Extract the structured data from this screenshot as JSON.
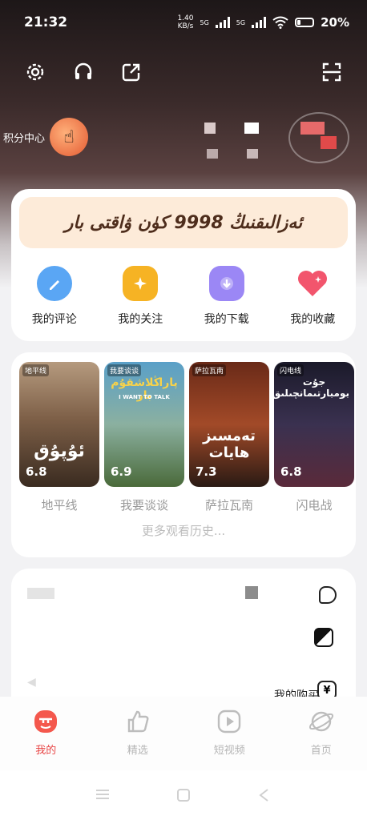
{
  "status": {
    "time": "21:32",
    "net_speed_value": "1.40",
    "net_speed_unit": "KB/s",
    "net_5g_a": "5G",
    "net_5g_b": "5G",
    "battery": "20%"
  },
  "toolbar": {
    "settings_icon": "gear-icon",
    "support_icon": "headset-icon",
    "share_icon": "external-share-icon",
    "scan_icon": "scan-icon"
  },
  "points": {
    "label": "积分中心"
  },
  "banner": {
    "text": "ئەزالىقنىڭ 9998 كۈن ۋاقتى بار"
  },
  "quick_actions": [
    {
      "label": "我的评论",
      "icon": "comment-icon",
      "color": "#5aa6f4"
    },
    {
      "label": "我的关注",
      "icon": "star-icon",
      "color": "#f6b324"
    },
    {
      "label": "我的下载",
      "icon": "download-icon",
      "color": "#9b87f5"
    },
    {
      "label": "我的收藏",
      "icon": "heart-icon",
      "color": "#f2556d"
    }
  ],
  "history": {
    "items": [
      {
        "tag": "地平线",
        "score": "6.8",
        "title": "地平线",
        "art": "ئۇپۇق"
      },
      {
        "tag": "我要谈谈",
        "score": "6.9",
        "title": "我要谈谈",
        "art": "پاراڭلاشقۇم بار",
        "subtitle": "I WANT TO TALK"
      },
      {
        "tag": "萨拉瓦南",
        "score": "7.3",
        "title": "萨拉瓦南",
        "art": "تەمسىز ھايات"
      },
      {
        "tag": "闪电线",
        "score": "6.8",
        "title": "闪电战",
        "art": "جۇت بومبارتىمانچىلىق"
      }
    ],
    "more": "更多观看历史..."
  },
  "purchase": {
    "label": "我的购买",
    "icon": "yen-icon"
  },
  "tabs": [
    {
      "label": "我的",
      "icon": "profile-icon",
      "active": true
    },
    {
      "label": "精选",
      "icon": "thumbs-up-icon",
      "active": false
    },
    {
      "label": "短视频",
      "icon": "video-icon",
      "active": false
    },
    {
      "label": "首页",
      "icon": "planet-icon",
      "active": false
    }
  ],
  "colors": {
    "accent": "#e84545",
    "banner_bg": "#fdebd9",
    "banner_text": "#4e2d1c"
  }
}
